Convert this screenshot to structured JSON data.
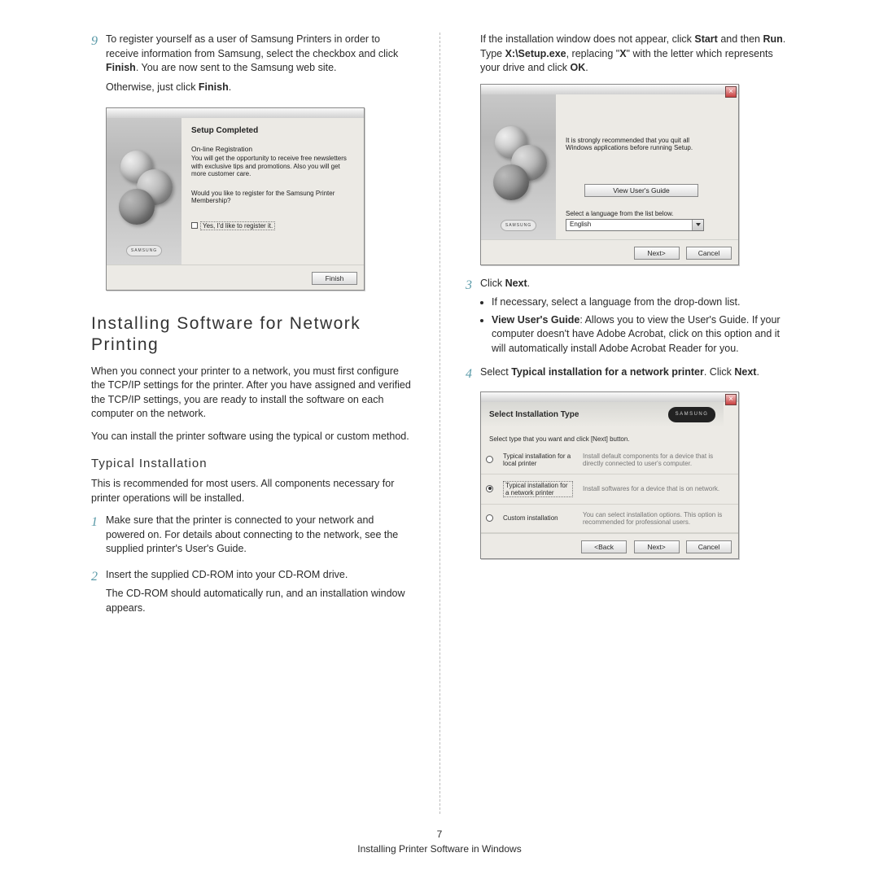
{
  "left": {
    "step9": {
      "num": "9",
      "p1a": "To register yourself as a user of Samsung Printers in order to receive information from Samsung, select the checkbox and click ",
      "p1b": "Finish",
      "p1c": ". You are now sent to the Samsung web site.",
      "p2a": "Otherwise, just click ",
      "p2b": "Finish",
      "p2c": "."
    },
    "dialog1": {
      "title": "Setup Completed",
      "sub": "On-line Registration",
      "desc": "You will get the opportunity to receive free newsletters with exclusive tips and promotions. Also you will get more customer care.",
      "q": "Would you like to register for the Samsung Printer Membership?",
      "chk": "Yes, I'd like to register it.",
      "logo": "SAMSUNG",
      "finish": "Finish"
    },
    "h2": "Installing Software for Network Printing",
    "p1": "When you connect your printer to a network, you must first configure the TCP/IP settings for the printer. After you have assigned and verified the TCP/IP settings, you are ready to install the software on each computer on the network.",
    "p2": "You can install the printer software using the typical or custom method.",
    "h3": "Typical Installation",
    "p3": "This is recommended for most users. All components necessary for printer operations will be installed.",
    "step1": {
      "num": "1",
      "text": "Make sure that the printer is connected to your network and powered on. For details about connecting to the network, see the supplied printer's User's Guide."
    },
    "step2": {
      "num": "2",
      "p1": "Insert the supplied CD-ROM into your CD-ROM drive.",
      "p2": "The CD-ROM should automatically run, and an installation window appears."
    }
  },
  "right": {
    "intro": {
      "a": "If the installation window does not appear, click ",
      "b": "Start",
      "c": " and then ",
      "d": "Run",
      "e": ". Type ",
      "f": "X:\\Setup.exe",
      "g": ", replacing \"",
      "h": "X",
      "i": "\" with the letter which represents your drive and click ",
      "j": "OK",
      "k": "."
    },
    "dialog2": {
      "rec": "It is strongly recommended that you quit all Windows applications before running Setup.",
      "guide": "View User's Guide",
      "langlbl": "Select a language from the list below.",
      "lang": "English",
      "logo": "SAMSUNG",
      "next": "Next>",
      "cancel": "Cancel"
    },
    "step3": {
      "num": "3",
      "p1a": "Click ",
      "p1b": "Next",
      "p1c": ".",
      "li1": "If necessary, select a language from the drop-down list.",
      "li2a": "View User's Guide",
      "li2b": ": Allows you to view the User's Guide. If your computer doesn't have Adobe Acrobat, click on this option and it will automatically install Adobe Acrobat Reader for you."
    },
    "step4": {
      "num": "4",
      "a": "Select ",
      "b": "Typical installation for a network printer",
      "c": ". Click ",
      "d": "Next",
      "e": "."
    },
    "dialog3": {
      "title": "Select Installation Type",
      "brand": "SAMSUNG",
      "prompt": "Select type that you want and click [Next] button.",
      "opt1lbl": "Typical installation for a local printer",
      "opt1desc": "Install default components for a device that is directly connected to user's computer.",
      "opt2lbl": "Typical installation for a network printer",
      "opt2desc": "Install softwares for a device that is on network.",
      "opt3lbl": "Custom installation",
      "opt3desc": "You can select installation options. This option is recommended for professional users.",
      "back": "<Back",
      "next": "Next>",
      "cancel": "Cancel"
    }
  },
  "footer": {
    "page": "7",
    "caption": "Installing Printer Software in Windows"
  }
}
